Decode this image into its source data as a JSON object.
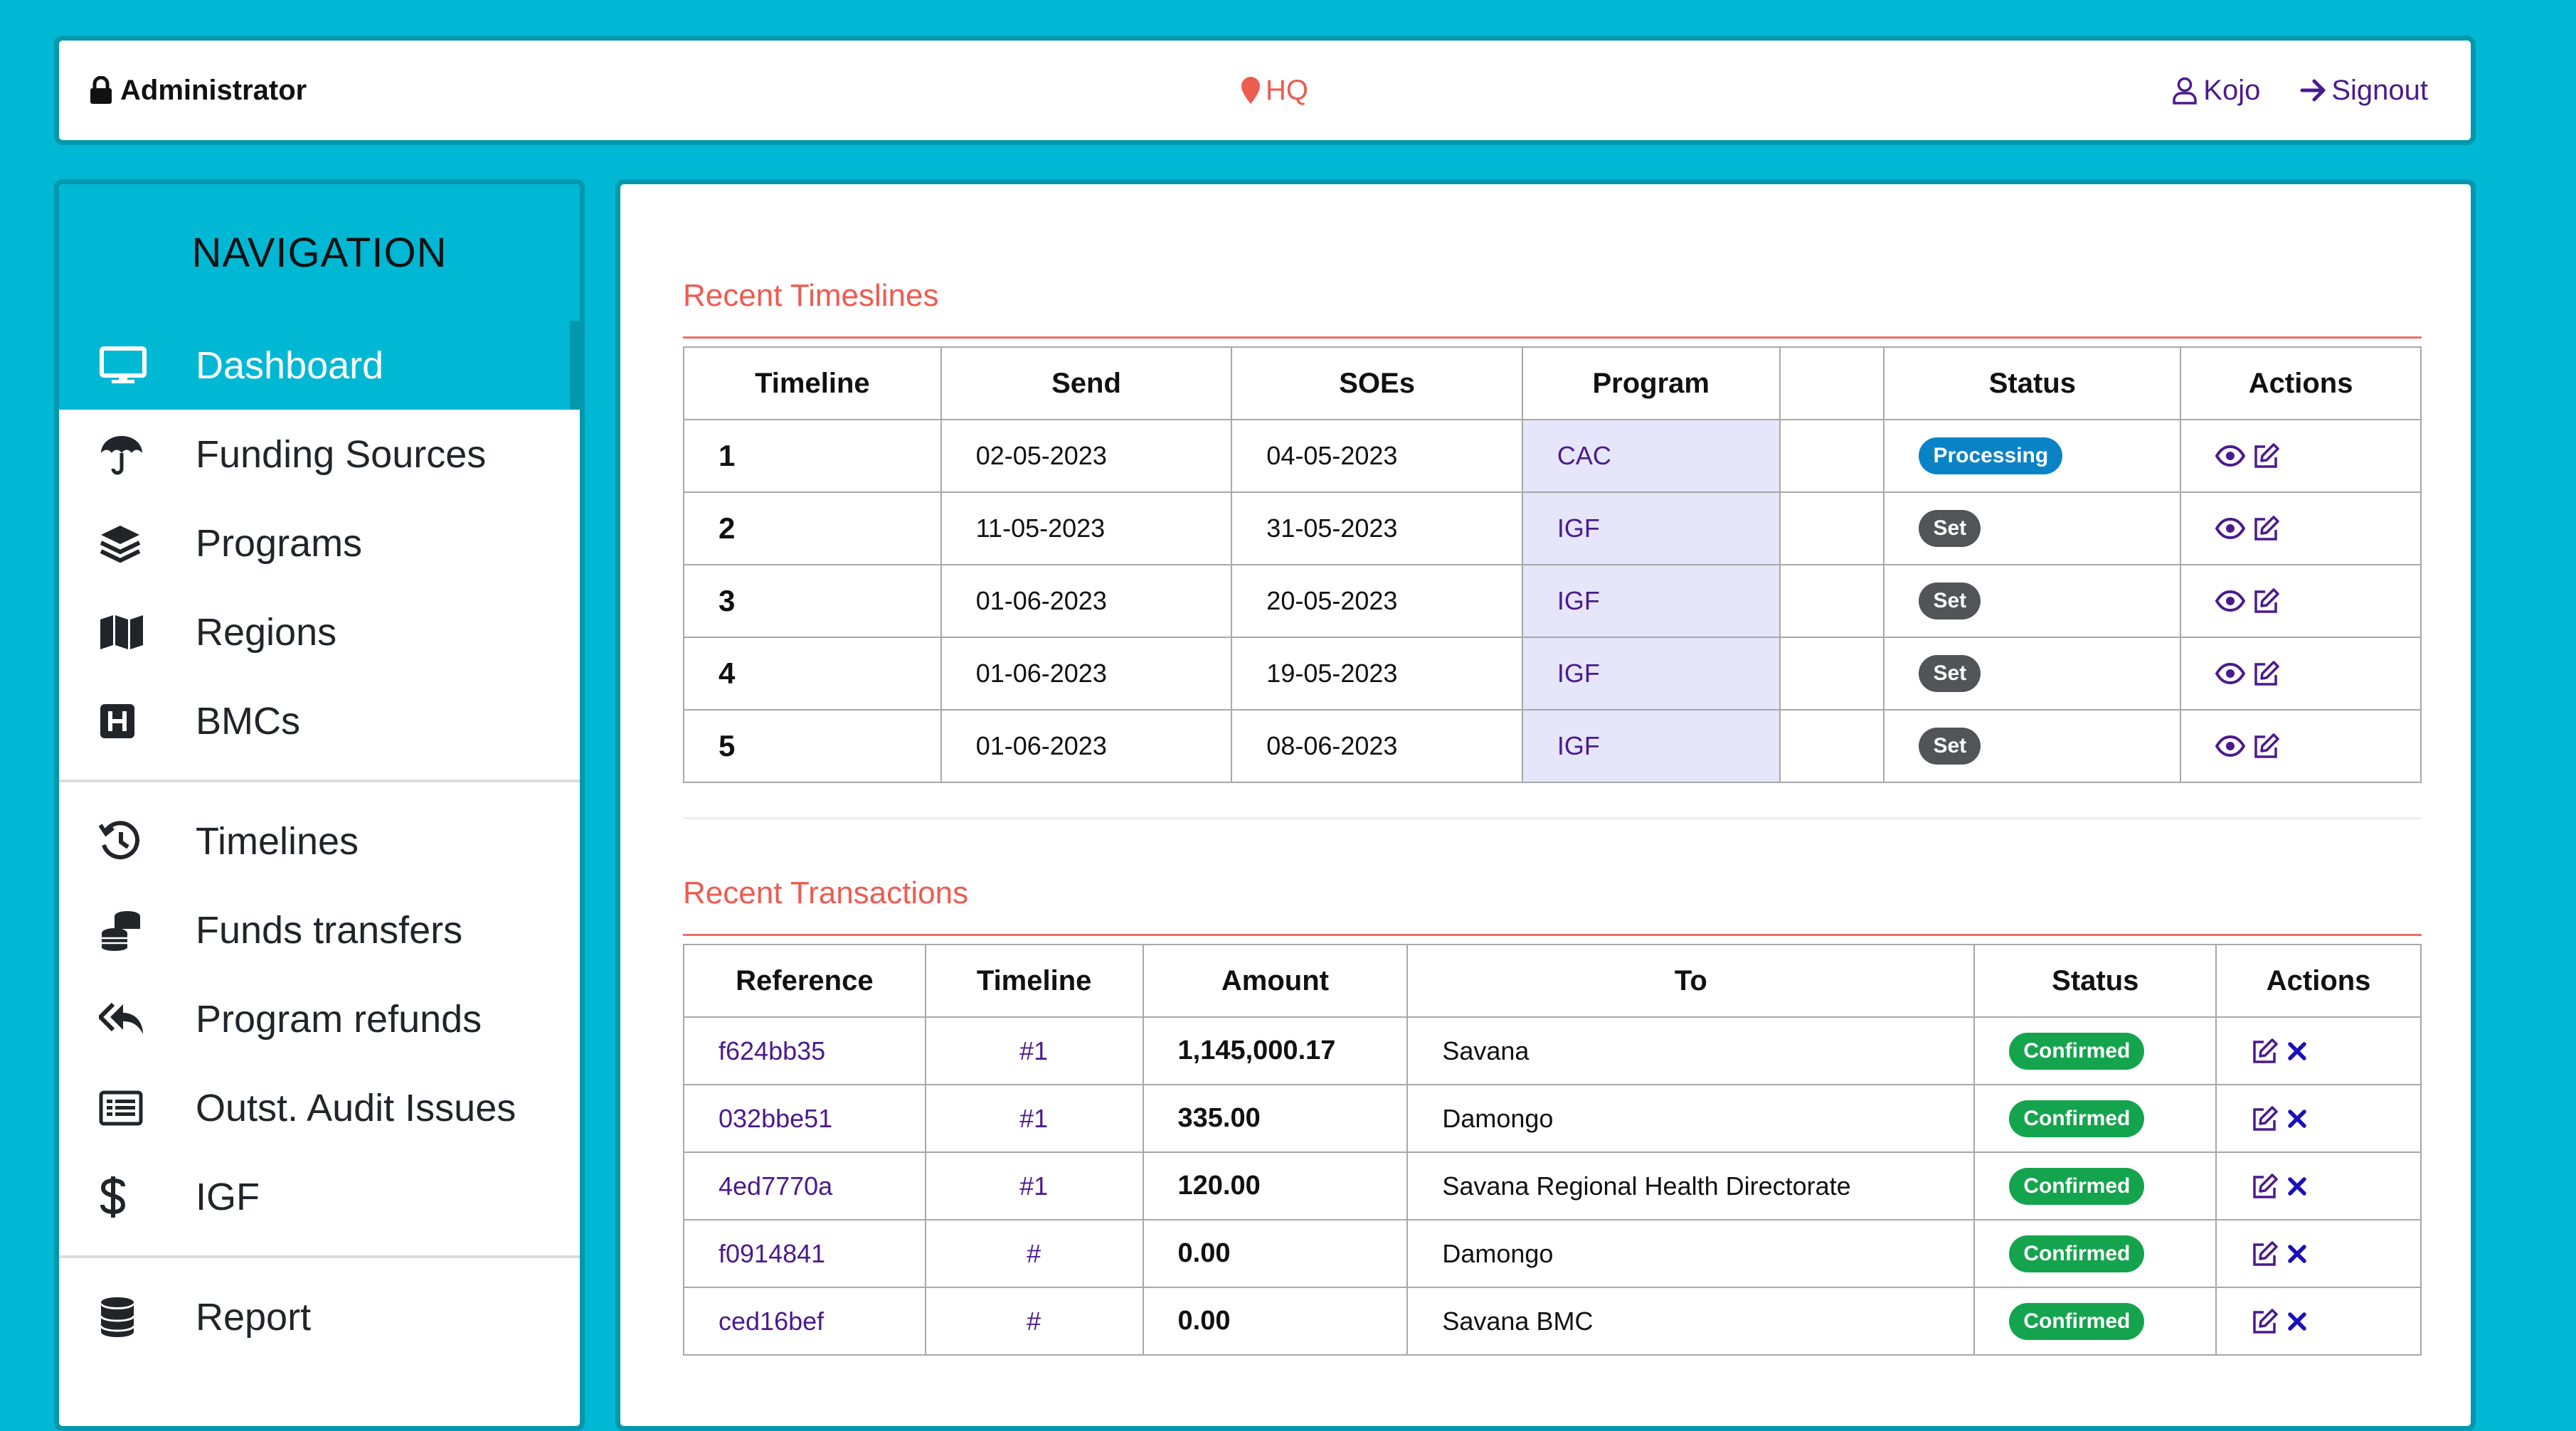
{
  "topbar": {
    "role": "Administrator",
    "location": "HQ",
    "user": "Kojo",
    "signout": "Signout"
  },
  "nav": {
    "title": "NAVIGATION",
    "items": [
      {
        "label": "Dashboard",
        "icon": "monitor-icon",
        "active": true
      },
      {
        "label": "Funding Sources",
        "icon": "umbrella-icon"
      },
      {
        "label": "Programs",
        "icon": "layers-icon"
      },
      {
        "label": "Regions",
        "icon": "map-icon"
      },
      {
        "label": "BMCs",
        "icon": "hospital-icon"
      },
      {
        "label": "Timelines",
        "icon": "history-icon"
      },
      {
        "label": "Funds transfers",
        "icon": "coins-icon"
      },
      {
        "label": "Program refunds",
        "icon": "reply-all-icon"
      },
      {
        "label": "Outst. Audit Issues",
        "icon": "list-alt-icon"
      },
      {
        "label": "IGF",
        "icon": "dollar-icon"
      },
      {
        "label": "Report",
        "icon": "database-icon"
      }
    ]
  },
  "timelines": {
    "title": "Recent Timeslines",
    "headers": [
      "Timeline",
      "Send",
      "SOEs",
      "Program",
      "",
      "Status",
      "Actions"
    ],
    "rows": [
      {
        "timeline": "1",
        "send": "02-05-2023",
        "soes": "04-05-2023",
        "program": "CAC",
        "extra": "",
        "status": "Processing"
      },
      {
        "timeline": "2",
        "send": "11-05-2023",
        "soes": "31-05-2023",
        "program": "IGF",
        "extra": "",
        "status": "Set"
      },
      {
        "timeline": "3",
        "send": "01-06-2023",
        "soes": "20-05-2023",
        "program": "IGF",
        "extra": "",
        "status": "Set"
      },
      {
        "timeline": "4",
        "send": "01-06-2023",
        "soes": "19-05-2023",
        "program": "IGF",
        "extra": "",
        "status": "Set"
      },
      {
        "timeline": "5",
        "send": "01-06-2023",
        "soes": "08-06-2023",
        "program": "IGF",
        "extra": "",
        "status": "Set"
      }
    ]
  },
  "transactions": {
    "title": "Recent Transactions",
    "headers": [
      "Reference",
      "Timeline",
      "Amount",
      "To",
      "Status",
      "Actions"
    ],
    "rows": [
      {
        "reference": "f624bb35",
        "timeline": "#1",
        "amount": "1,145,000.17",
        "to": "Savana",
        "status": "Confirmed"
      },
      {
        "reference": "032bbe51",
        "timeline": "#1",
        "amount": "335.00",
        "to": "Damongo",
        "status": "Confirmed"
      },
      {
        "reference": "4ed7770a",
        "timeline": "#1",
        "amount": "120.00",
        "to": "Savana Regional Health Directorate",
        "status": "Confirmed"
      },
      {
        "reference": "f0914841",
        "timeline": "#",
        "amount": "0.00",
        "to": "Damongo",
        "status": "Confirmed"
      },
      {
        "reference": "ced16bef",
        "timeline": "#",
        "amount": "0.00",
        "to": "Savana BMC",
        "status": "Confirmed"
      }
    ]
  },
  "colors": {
    "background": "#01b8d4",
    "accent": "#ee5b4f",
    "link": "#4b1a8e",
    "processing": "#0a83c6",
    "set": "#525458",
    "confirmed": "#14a44d"
  }
}
